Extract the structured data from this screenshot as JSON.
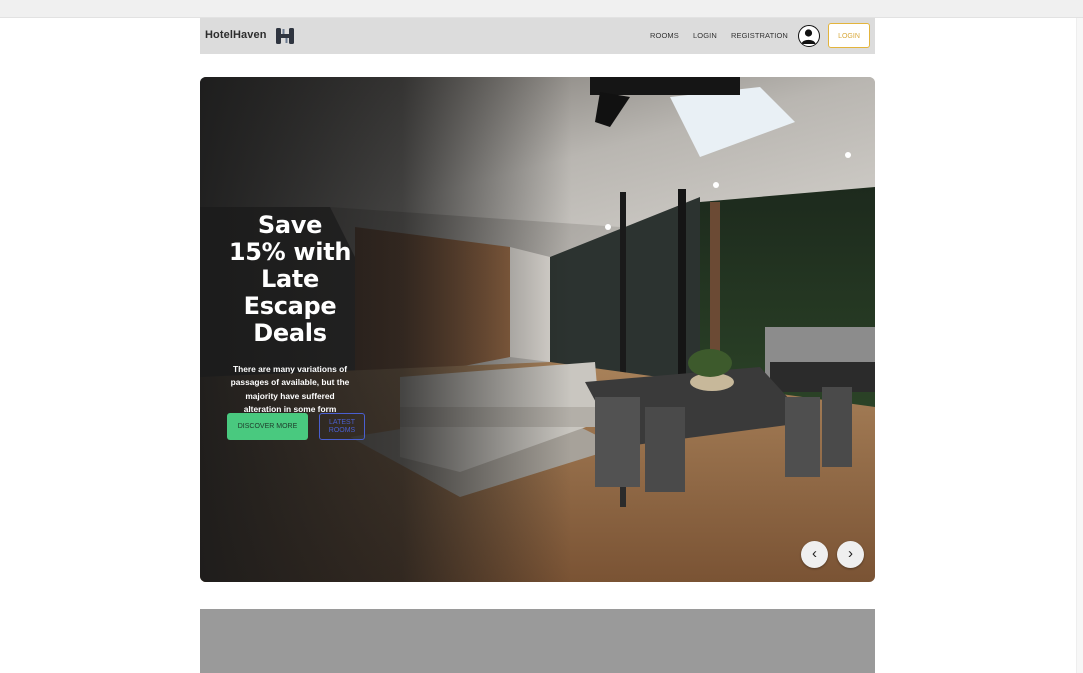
{
  "navbar": {
    "brand": "HotelHaven",
    "links": [
      "ROOMS",
      "LOGIN",
      "REGISTRATION"
    ],
    "login_button": "LOGIN",
    "accent_color": "#e3b43c"
  },
  "hero": {
    "title": "Save 15% with Late Escape Deals",
    "subtitle": "There are many variations of passages of available, but the majority have suffered alteration in some form",
    "primary_button": "DISCOVER MORE",
    "secondary_button": "LATEST ROOMS",
    "primary_color": "#49c97f",
    "secondary_color": "#4a5fd0",
    "prev_icon": "chevron-left-icon",
    "next_icon": "chevron-right-icon"
  },
  "icons": {
    "logo": "hotel-h-logo-icon",
    "avatar": "user-avatar-icon"
  }
}
